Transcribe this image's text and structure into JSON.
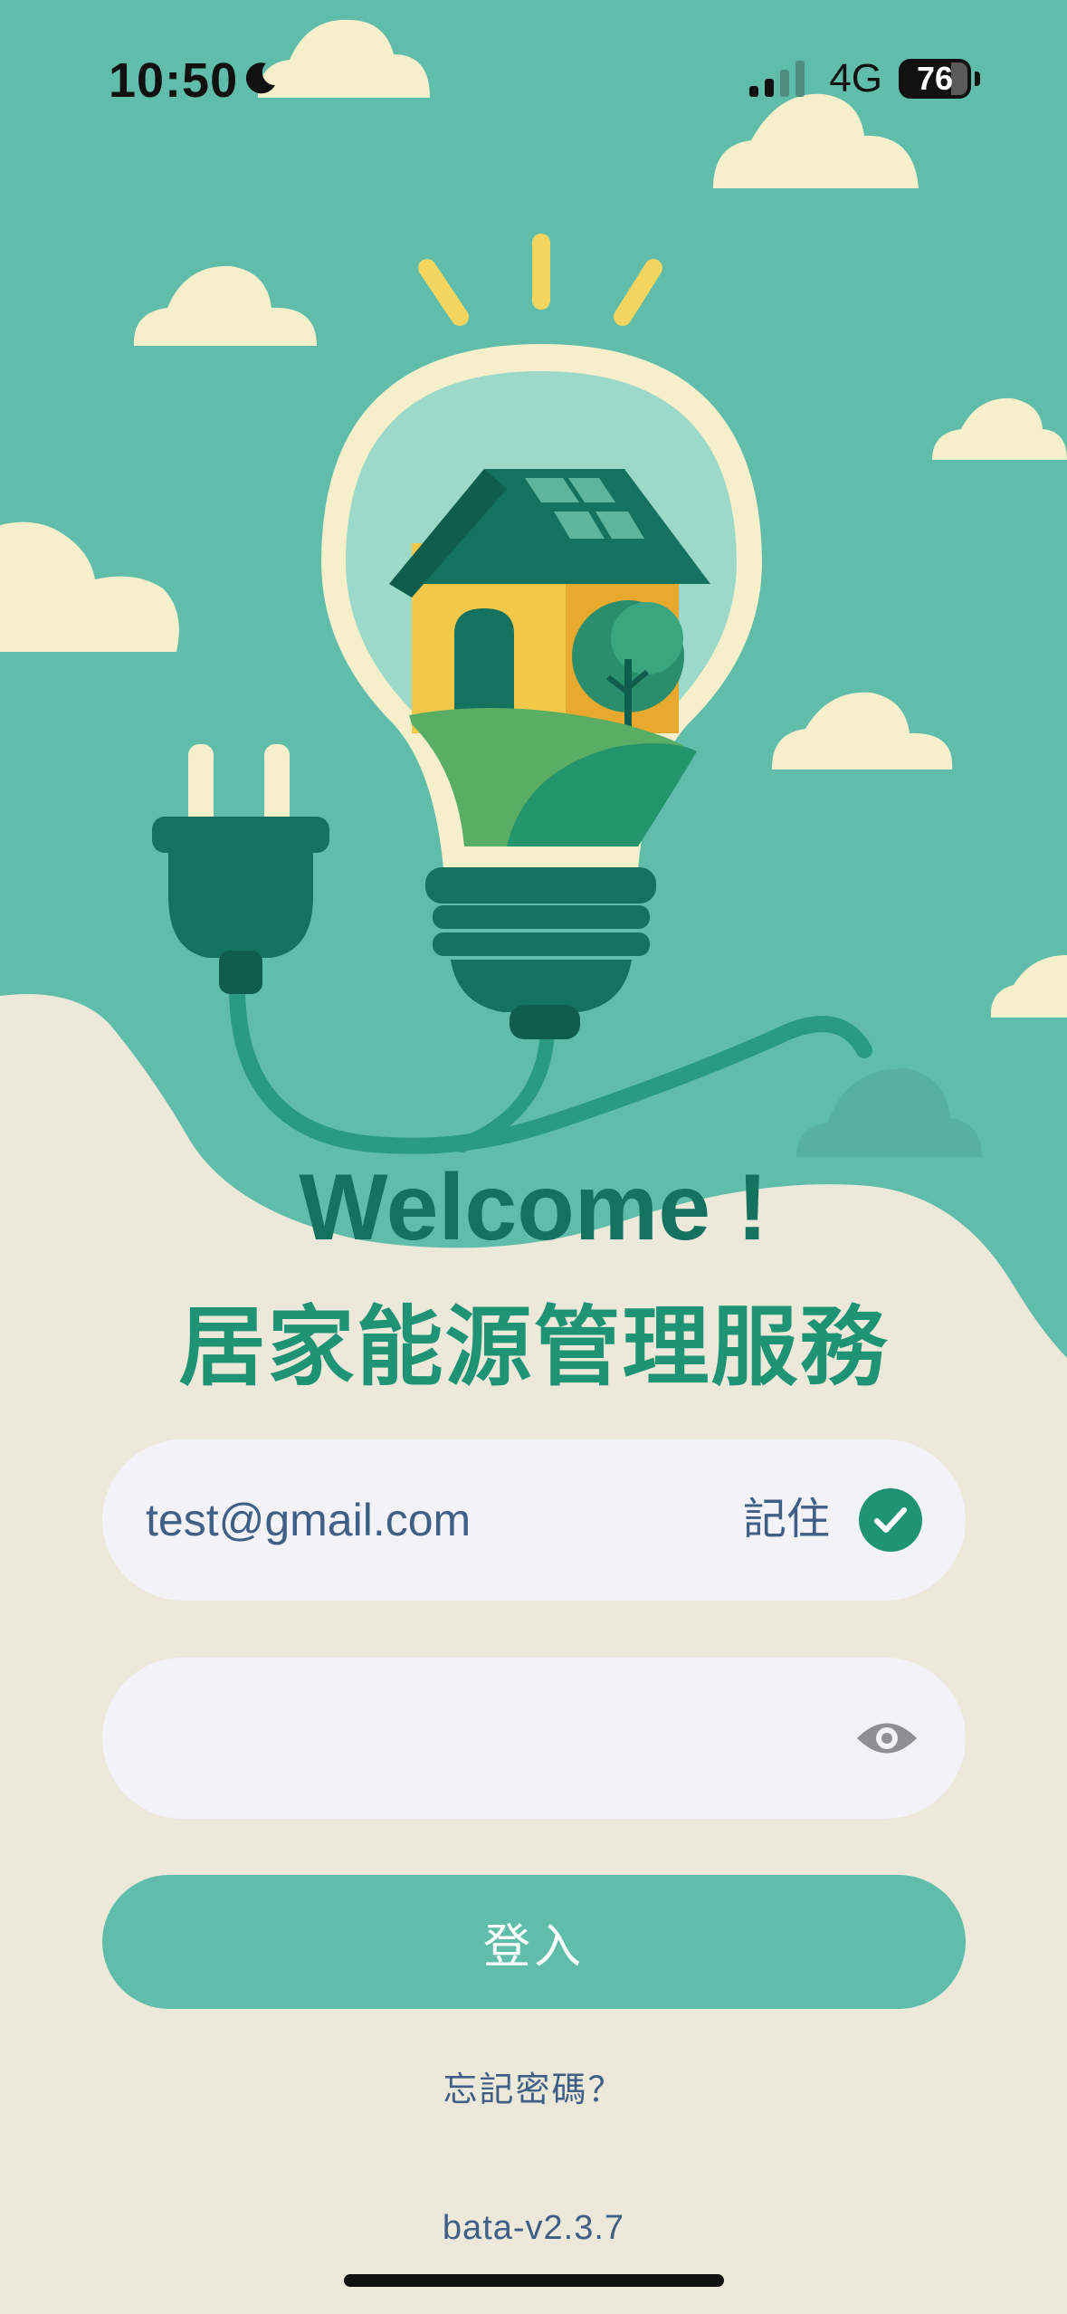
{
  "status_bar": {
    "time": "10:50",
    "network": "4G",
    "battery": "76"
  },
  "hero": {
    "welcome": "Welcome !",
    "subtitle": "居家能源管理服務"
  },
  "login_form": {
    "email_value": "test@gmail.com",
    "remember_label": "記住",
    "remember_checked": true,
    "password_value": "",
    "login_label": "登入",
    "forgot_password": "忘記密碼？"
  },
  "footer": {
    "version": "bata-v2.3.7"
  },
  "colors": {
    "teal_bg": "#5fbdaa",
    "dark_green": "#15725e",
    "accent": "#1f9475",
    "cream": "#ece8da",
    "field_bg": "#f2f2f7",
    "text_blue": "#3f5f87"
  },
  "icons": [
    "moon-icon",
    "signal-icon",
    "battery-icon",
    "check-icon",
    "eye-icon",
    "lightbulb-house-illustration",
    "plug-icon",
    "cloud-icon"
  ]
}
